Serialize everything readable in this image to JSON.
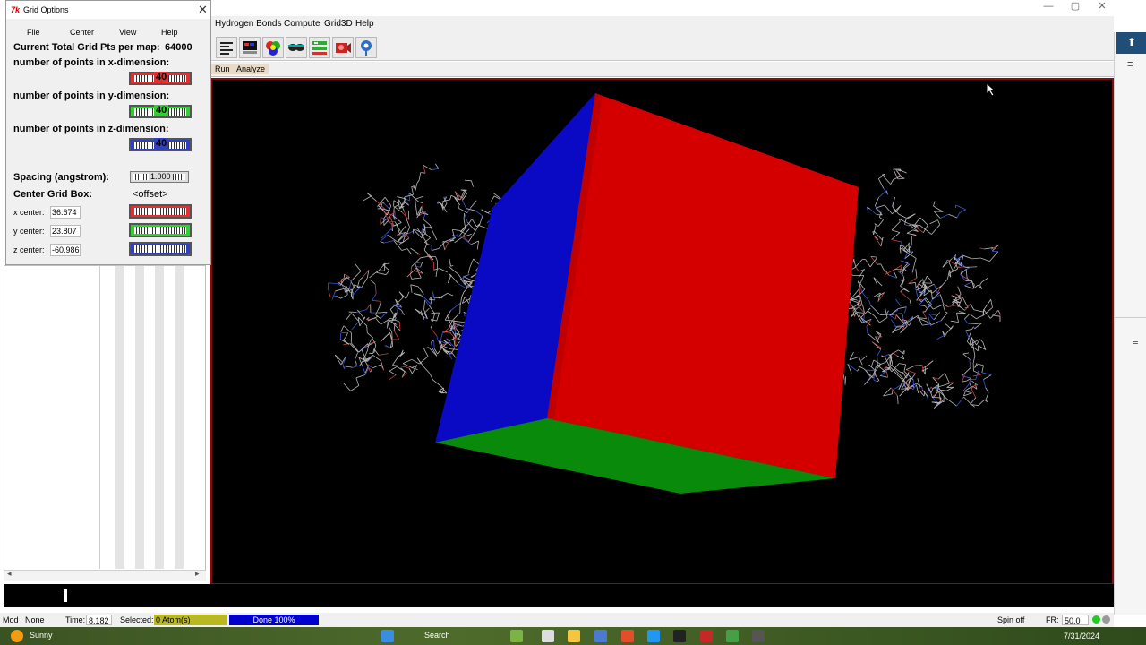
{
  "app": {
    "menu": [
      "Hydrogen Bonds",
      "Compute",
      "Grid3D",
      "Help"
    ],
    "subtabs": [
      "Run",
      "Analyze"
    ]
  },
  "grid_dialog": {
    "title": "Grid Options",
    "menu": [
      "File",
      "Center",
      "View",
      "Help"
    ],
    "total_points_label": "Current Total Grid Pts per map:",
    "total_points_value": "64000",
    "x_dim_label": "number of points in x-dimension:",
    "x_dim_value": "40",
    "y_dim_label": "number of points in y-dimension:",
    "y_dim_value": "40",
    "z_dim_label": "number of points in z-dimension:",
    "z_dim_value": "40",
    "spacing_label": "Spacing (angstrom):",
    "spacing_value": "1.000",
    "center_label": "Center Grid Box:",
    "center_mode": "<offset>",
    "x_center_label": "x center:",
    "x_center_value": "36.674",
    "y_center_label": "y center:",
    "y_center_value": "23.807",
    "z_center_label": "z center:",
    "z_center_value": "-60.986"
  },
  "status": {
    "mod_label": "Mod",
    "mod_value": "None",
    "time_label": "Time:",
    "time_value": "8.182",
    "selected_label": "Selected:",
    "selected_value": "0 Atom(s)",
    "done_value": "Done 100%",
    "spin_value": "Spin off",
    "fr_label": "FR:",
    "fr_value": "50.0"
  },
  "taskbar": {
    "weather": "Sunny",
    "search_label": "Search",
    "date": "7/31/2024"
  },
  "colors": {
    "box_red": "#d40000",
    "box_blue": "#0a0ac4",
    "box_green": "#0a8a0a",
    "viewport_bg": "#000000"
  }
}
